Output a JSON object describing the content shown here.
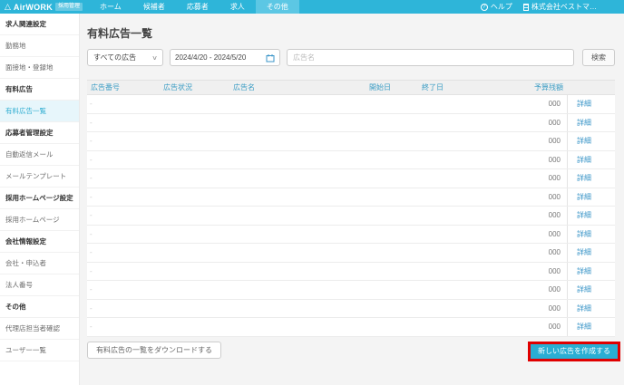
{
  "navbar": {
    "logo": "AirWORK",
    "badge": "採用管理",
    "menu": [
      {
        "label": "ホーム",
        "active": false
      },
      {
        "label": "候補者",
        "active": false
      },
      {
        "label": "応募者",
        "active": false
      },
      {
        "label": "求人",
        "active": false
      },
      {
        "label": "その他",
        "active": true
      }
    ],
    "help": "ヘルプ",
    "account": "株式会社ベストマ…"
  },
  "sidebar": {
    "entries": [
      {
        "type": "header",
        "label": "求人関連設定"
      },
      {
        "type": "item",
        "label": "勤務地"
      },
      {
        "type": "item",
        "label": "面接地・登録地"
      },
      {
        "type": "header",
        "label": "有料広告"
      },
      {
        "type": "item",
        "label": "有料広告一覧",
        "active": true
      },
      {
        "type": "header",
        "label": "応募者管理設定"
      },
      {
        "type": "item",
        "label": "自動返信メール"
      },
      {
        "type": "item",
        "label": "メールテンプレート"
      },
      {
        "type": "header",
        "label": "採用ホームページ設定"
      },
      {
        "type": "item",
        "label": "採用ホームページ"
      },
      {
        "type": "header",
        "label": "会社情報設定"
      },
      {
        "type": "item",
        "label": "会社・申込者"
      },
      {
        "type": "item",
        "label": "法人番号"
      },
      {
        "type": "header",
        "label": "その他"
      },
      {
        "type": "item",
        "label": "代理店担当者確認"
      },
      {
        "type": "item",
        "label": "ユーザー一覧"
      }
    ]
  },
  "main": {
    "title": "有料広告一覧",
    "filters": {
      "type_select": "すべての広告",
      "date_range": "2024/4/20 - 2024/5/20",
      "name_placeholder": "広告名",
      "search_button": "検索"
    },
    "table": {
      "columns": [
        "広告番号",
        "広告状況",
        "広告名",
        "開始日",
        "終了日",
        "予算残額"
      ],
      "detail_label": "詳細",
      "rows": [
        {
          "mark": "-",
          "budget": "000"
        },
        {
          "mark": "-",
          "budget": "000"
        },
        {
          "mark": "-",
          "budget": "000"
        },
        {
          "mark": "-",
          "budget": "000"
        },
        {
          "mark": "-",
          "budget": "000"
        },
        {
          "mark": "-",
          "budget": "000"
        },
        {
          "mark": "-",
          "budget": "000"
        },
        {
          "mark": "-",
          "budget": "000"
        },
        {
          "mark": "-",
          "budget": "000"
        },
        {
          "mark": "-",
          "budget": "000"
        },
        {
          "mark": "-",
          "budget": "000"
        },
        {
          "mark": "-",
          "budget": "000"
        },
        {
          "mark": "-",
          "budget": "000"
        }
      ]
    },
    "download_button": "有料広告の一覧をダウンロードする",
    "create_button": "新しい広告を作成する"
  },
  "colors": {
    "navbar": "#2eb5d9",
    "navbar_active_tab": "#5cc7e4",
    "accent": "#2aaed3",
    "table_header_text": "#3a9cc4",
    "link": "#3b96c8",
    "annotation_highlight": "#e00000"
  },
  "annotation": {
    "highlighted_element": "create-button",
    "highlight_color": "#e00000"
  }
}
